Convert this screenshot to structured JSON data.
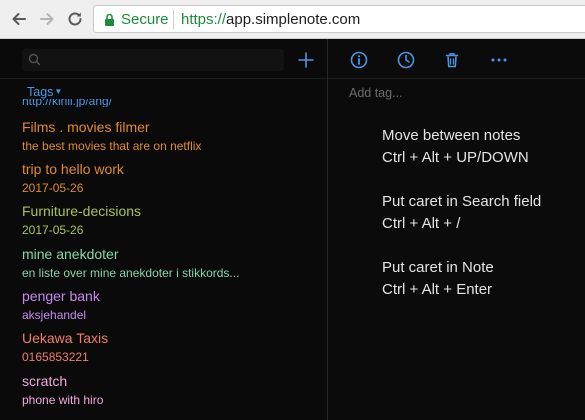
{
  "browser": {
    "secure_label": "Secure",
    "url_scheme": "https://",
    "url_host": "app.simplenote.com"
  },
  "sidebar": {
    "search_placeholder": "",
    "tags_label": "Tags",
    "notes": [
      {
        "title": "http://kiriii.jp/ang/",
        "subtitle": "",
        "color": "#4c96e6"
      },
      {
        "title": "Films . movies filmer",
        "subtitle": "the best movies that are on netflix",
        "color": "#e08a2a"
      },
      {
        "title": "trip to hello work",
        "subtitle": "2017-05-26",
        "color": "#e08a2a"
      },
      {
        "title": "Furniture-decisions",
        "subtitle": "2017-05-26",
        "color": "#a6c45a"
      },
      {
        "title": "mine anekdoter",
        "subtitle": "en liste over mine anekdoter i stikkords...",
        "color": "#86d6a8"
      },
      {
        "title": "penger bank",
        "subtitle": "aksjehandel",
        "color": "#c58af0"
      },
      {
        "title": "Uekawa Taxis",
        "subtitle": "0165853221",
        "color": "#f27c6a"
      },
      {
        "title": "scratch",
        "subtitle": "phone with hiro",
        "color": "#f2a8dd"
      },
      {
        "title": "...",
        "subtitle": "",
        "color": "#a6c45a"
      }
    ]
  },
  "editor": {
    "add_tag_placeholder": "Add tag...",
    "lines": [
      "Move between notes",
      "Ctrl + Alt + UP/DOWN",
      "",
      "Put caret in Search field",
      "Ctrl + Alt + /",
      "",
      "Put caret in Note",
      "Ctrl + Alt + Enter"
    ]
  },
  "colors": {
    "accent": "#4c96e6",
    "secure_green": "#1e8a3e",
    "background": "#0b0b0b"
  },
  "icons": [
    "back-arrow-icon",
    "forward-arrow-icon",
    "reload-icon",
    "lock-icon",
    "search-icon",
    "plus-icon",
    "info-icon",
    "history-icon",
    "trash-icon",
    "more-icon"
  ]
}
